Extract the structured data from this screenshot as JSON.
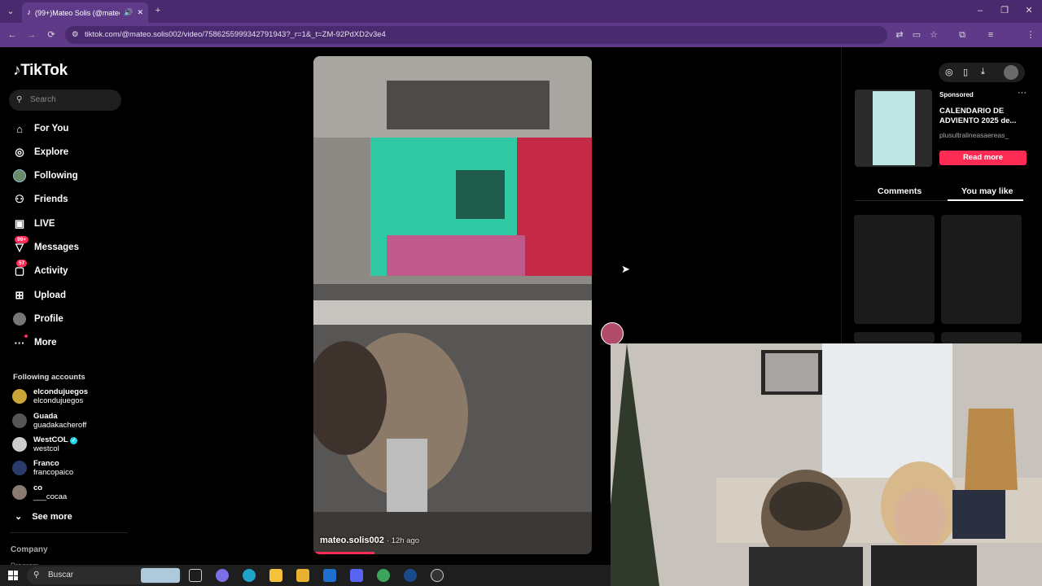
{
  "browser": {
    "tab_title": "(99+)Mateo Solis (@mateo...",
    "url": "tiktok.com/@mateo.solis002/video/7586255999342791943?_r=1&_t=ZM-92PdXD2v3e4",
    "new_tab_icon": "plus-icon",
    "accent": "#5e3a88"
  },
  "sidebar": {
    "logo_text": "TikTok",
    "search_placeholder": "Search",
    "nav": [
      {
        "label": "For You",
        "icon": "home-icon"
      },
      {
        "label": "Explore",
        "icon": "compass-icon"
      },
      {
        "label": "Following",
        "icon": "avatar-icon"
      },
      {
        "label": "Friends",
        "icon": "friends-icon"
      },
      {
        "label": "LIVE",
        "icon": "live-icon"
      },
      {
        "label": "Messages",
        "icon": "messages-icon",
        "badge": "99+"
      },
      {
        "label": "Activity",
        "icon": "activity-icon",
        "badge": "57"
      },
      {
        "label": "Upload",
        "icon": "upload-icon"
      },
      {
        "label": "Profile",
        "icon": "profile-icon"
      },
      {
        "label": "More",
        "icon": "more-icon"
      }
    ],
    "following_title": "Following accounts",
    "accounts": [
      {
        "name": "elcondujuegos",
        "handle": "elcondujuegos"
      },
      {
        "name": "Guada",
        "handle": "guadakacheroff"
      },
      {
        "name": "WestCOL",
        "handle": "westcol",
        "verified": true
      },
      {
        "name": "Franco",
        "handle": "francopaico"
      },
      {
        "name": "co",
        "handle": "___cocaa"
      }
    ],
    "see_more": "See more",
    "company": "Company",
    "program": "Program"
  },
  "video": {
    "username": "mateo.solis002",
    "time_ago": "· 12h ago",
    "progress_fraction": 0.22
  },
  "ad": {
    "sponsored": "Sponsored",
    "title": "CALENDARIO DE ADVIENTO 2025 de...",
    "handle": "plusultralineasaereas_",
    "cta": "Read more"
  },
  "panel_tabs": {
    "comments": "Comments",
    "you_may_like": "You may like"
  },
  "taskbar": {
    "search_label": "Buscar"
  },
  "colors": {
    "tiktok_red": "#fe2c55"
  }
}
